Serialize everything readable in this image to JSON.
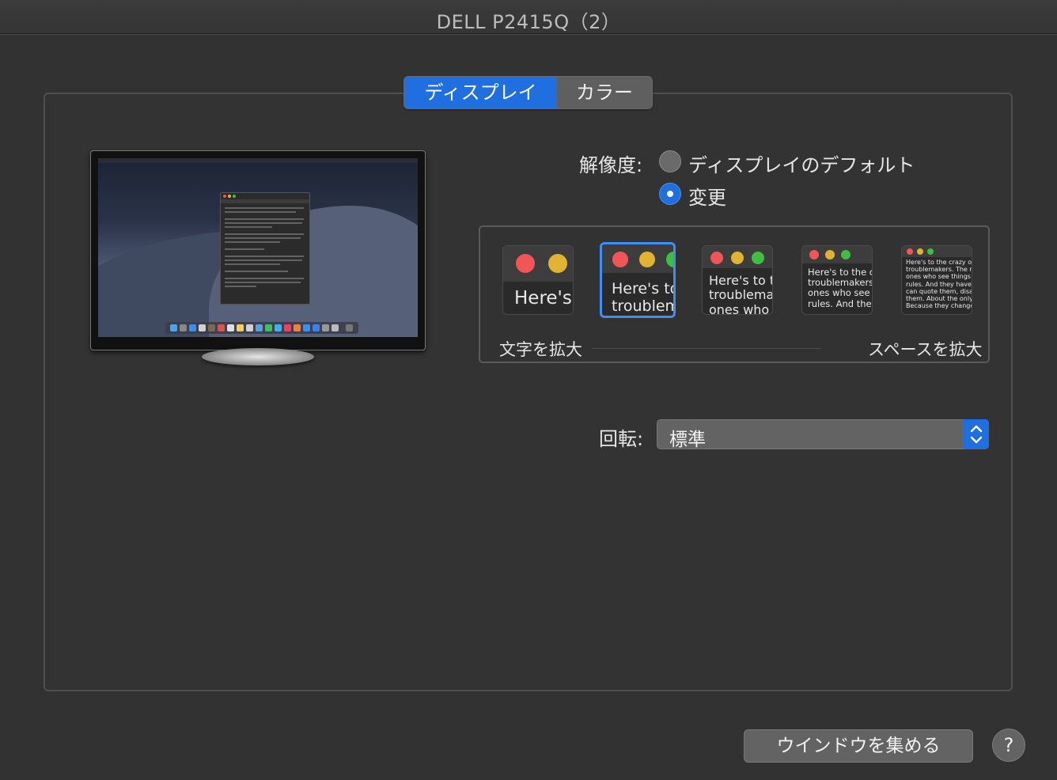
{
  "window": {
    "title": "DELL P2415Q（2）"
  },
  "tabs": [
    {
      "label": "ディスプレイ",
      "active": true
    },
    {
      "label": "カラー",
      "active": false
    }
  ],
  "resolution": {
    "label": "解像度:",
    "options": [
      {
        "label": "ディスプレイのデフォルト",
        "selected": false
      },
      {
        "label": "変更",
        "selected": true
      }
    ],
    "scaled": {
      "selected_index": 1,
      "samples": [
        "Here's",
        "Here's to\ntroublem",
        "Here's to t\ntroublema\nones who",
        "Here's to the cr\ntroublemakers.\nones who see t\nrules. And they",
        "Here's to the crazy one\ntroublemakers. The rou\nones who see things dif\nrules. And they have no\ncan quote them, disagre\nthem. About the only th\nBecause they change th"
      ],
      "left_label": "文字を拡大",
      "right_label": "スペースを拡大"
    }
  },
  "rotation": {
    "label": "回転:",
    "value": "標準"
  },
  "buttons": {
    "gather": "ウインドウを集める",
    "help": "?"
  },
  "colors": {
    "accent": "#1f6fe0",
    "red": "#f25555",
    "yellow": "#e0b430",
    "green": "#3fbf3f"
  }
}
